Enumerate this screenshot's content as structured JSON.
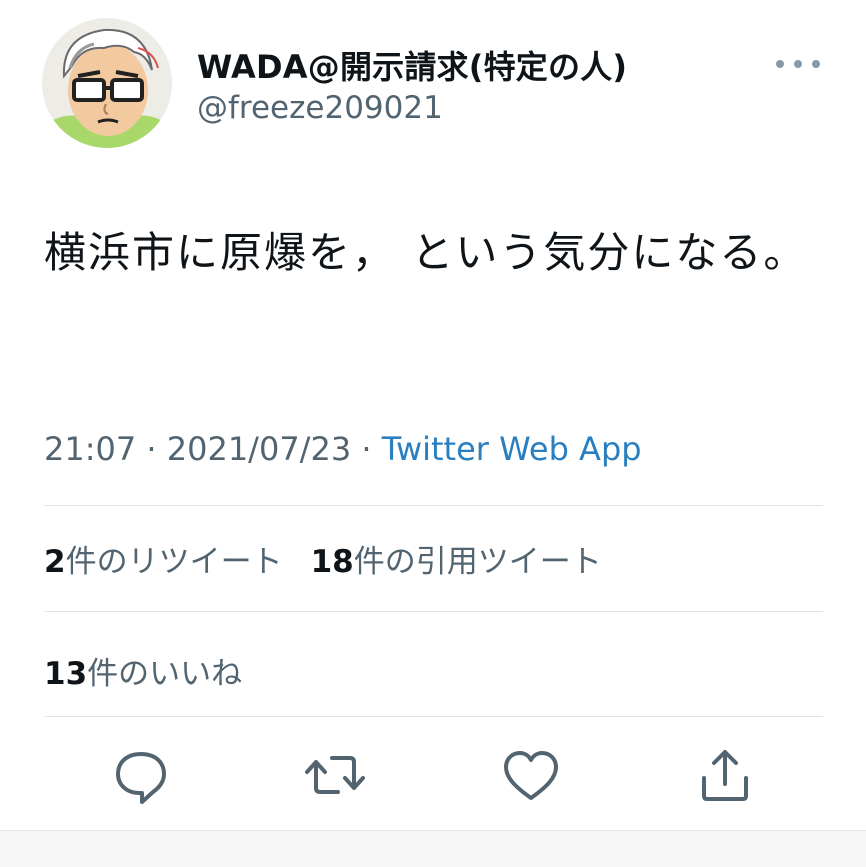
{
  "user": {
    "display_name": "WADA@開示請求(特定の人)",
    "handle": "@freeze209021"
  },
  "tweet": {
    "text": "横浜市に原爆を， という気分になる。",
    "time": "21:07",
    "separator": " · ",
    "date": "2021/07/23",
    "source": "Twitter Web App"
  },
  "stats": {
    "retweets_count": "2",
    "retweets_label": "件のリツイート",
    "quotes_count": "18",
    "quotes_label": "件の引用ツイート",
    "likes_count": "13",
    "likes_label": "件のいいね"
  },
  "icons": {
    "more": "more-options-icon",
    "reply": "reply-icon",
    "retweet": "retweet-icon",
    "like": "heart-icon",
    "share": "share-icon"
  },
  "colors": {
    "link": "#2a7fc0",
    "muted": "#536471",
    "icon": "#536471"
  }
}
